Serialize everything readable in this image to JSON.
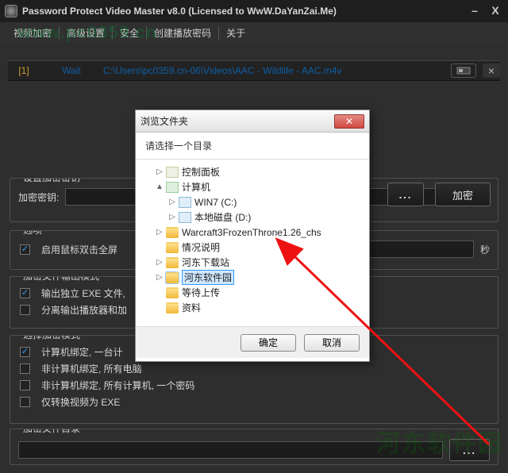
{
  "app": {
    "title": "Password Protect Video Master v8.0 (Licensed to WwW.DaYanZai.Me)",
    "menus": [
      "视频加密",
      "高级设置",
      "安全",
      "创建播放密码",
      "关于"
    ]
  },
  "watermark": {
    "url": "www.pc0359.cn",
    "brand": "河东软件园"
  },
  "file": {
    "index": "[1]",
    "status": "Wait",
    "path": "C:\\Users\\pc0359.cn-06\\Videos\\AAC - Wildlife - AAC.m4v"
  },
  "panels": {
    "keyset": {
      "legend": "设置加密密钥",
      "key_label": "加密密钥:",
      "dots": "...",
      "encrypt": "加密"
    },
    "option": {
      "legend": "选项",
      "chk_fullscreen": "启用鼠标双击全屏",
      "seconds_suffix": "秒"
    },
    "outmode": {
      "legend": "加密文件输出模式",
      "chk_exe": "输出独立 EXE 文件,",
      "chk_split": "分离输出播放器和加"
    },
    "encmode": {
      "legend": "选择加密模式",
      "r1": "计算机绑定, 一台计",
      "r2": "非计算机绑定, 所有电脑",
      "r3": "非计算机绑定, 所有计算机, 一个密码",
      "r4": "仅转换视频为 EXE"
    },
    "outdir": {
      "legend": "加密文件目录",
      "dots": "..."
    }
  },
  "dialog": {
    "title": "浏览文件夹",
    "subtitle": "请选择一个目录",
    "tree": [
      {
        "indent": 1,
        "tw": "▷",
        "icon": "panel",
        "label": "控制面板"
      },
      {
        "indent": 1,
        "tw": "▲",
        "icon": "pc",
        "label": "计算机"
      },
      {
        "indent": 2,
        "tw": "▷",
        "icon": "drive",
        "label": "WIN7 (C:)"
      },
      {
        "indent": 2,
        "tw": "▷",
        "icon": "drive",
        "label": "本地磁盘 (D:)"
      },
      {
        "indent": 1,
        "tw": "▷",
        "icon": "folder",
        "label": "Warcraft3FrozenThrone1.26_chs"
      },
      {
        "indent": 1,
        "tw": "",
        "icon": "folder",
        "label": "情况说明"
      },
      {
        "indent": 1,
        "tw": "▷",
        "icon": "folder",
        "label": "河东下载站"
      },
      {
        "indent": 1,
        "tw": "▷",
        "icon": "folder",
        "label": "河东软件园",
        "selected": true
      },
      {
        "indent": 1,
        "tw": "",
        "icon": "folder",
        "label": "等待上传"
      },
      {
        "indent": 1,
        "tw": "",
        "icon": "folder",
        "label": "资料"
      }
    ],
    "ok": "确定",
    "cancel": "取消"
  }
}
